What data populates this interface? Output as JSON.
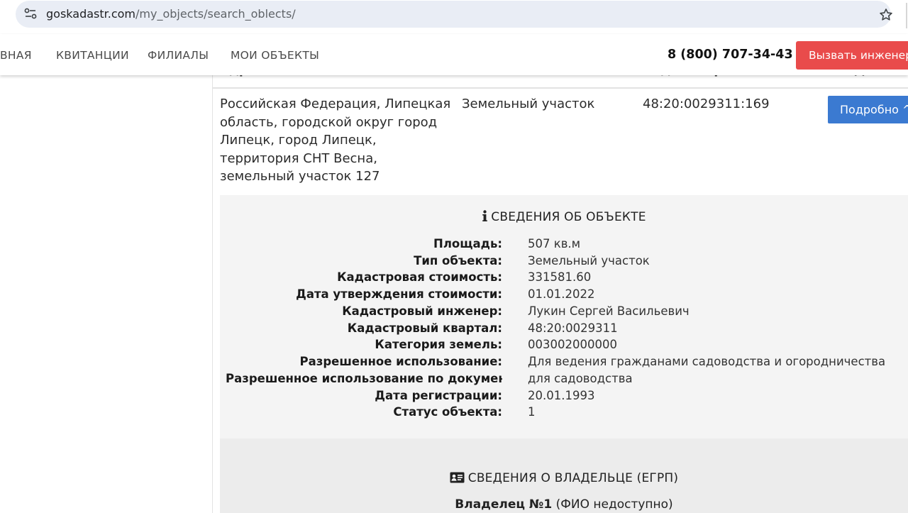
{
  "browser": {
    "url_host": "goskadastr.com",
    "url_path": "/my_objects/search_oblects/",
    "icons": [
      "site-info-icon",
      "star-icon"
    ]
  },
  "header": {
    "nav": [
      "ВНАЯ",
      "КВИТАНЦИИ",
      "ФИЛИАЛЫ",
      "МОИ ОБЪЕКТЫ"
    ],
    "phone": "8 (800) 707-34-43",
    "call_button": "Вызвать инженера"
  },
  "table": {
    "headers": [
      "Адрес",
      "Тип",
      "Кад. номер",
      "Действия"
    ],
    "row": {
      "address_lines": [
        "Российская Федерация, Липецкая",
        "область, городской округ город",
        "Липецк, город Липецк,",
        "территория СНТ Весна,",
        "земельный участок 127"
      ],
      "type": "Земельный участок",
      "cadastral_number": "48:20:0029311:169",
      "details_button": "Подробно ^"
    }
  },
  "object_info": {
    "title": "СВЕДЕНИЯ ОБ ОБЪЕКТЕ",
    "title_icon": "info-icon",
    "fields": [
      {
        "label": "Площадь:",
        "value": "507 кв.м"
      },
      {
        "label": "Тип объекта:",
        "value": "Земельный участок"
      },
      {
        "label": "Кадастровая стоимость:",
        "value": "331581.60"
      },
      {
        "label": "Дата утверждения стоимости:",
        "value": "01.01.2022"
      },
      {
        "label": "Кадастровый инженер:",
        "value": "Лукин Сергей Васильевич"
      },
      {
        "label": "Кадастровый квартал:",
        "value": "48:20:0029311"
      },
      {
        "label": "Категория земель:",
        "value": "003002000000"
      },
      {
        "label": "Разрешенное использование:",
        "value": "Для ведения гражданами садоводства и огородничества"
      },
      {
        "label": "Разрешенное использование по докумен...",
        "value": "для садоводства"
      },
      {
        "label": "Дата регистрации:",
        "value": "20.01.1993"
      },
      {
        "label": "Статус объекта:",
        "value": "1"
      }
    ]
  },
  "owner_info": {
    "title": "СВЕДЕНИЯ О ВЛАДЕЛЬЦЕ (ЕГРП)",
    "title_icon": "id-card-icon",
    "owner_label": "Владелец №1",
    "owner_value": "(ФИО недоступно)"
  }
}
